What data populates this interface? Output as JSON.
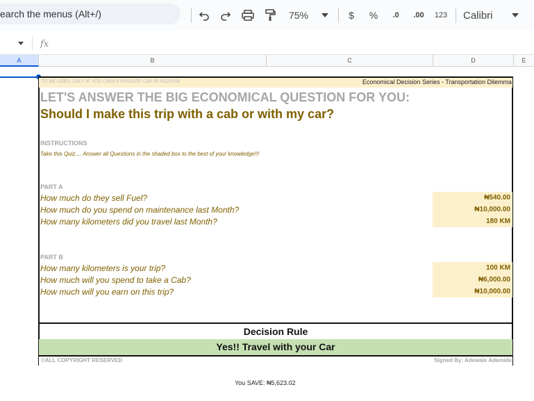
{
  "toolbar": {
    "search_text": "earch the menus (Alt+/)",
    "zoom": "75%",
    "currency_symbol": "$",
    "percent_symbol": "%",
    "decrease_decimal": ".0",
    "increase_decimal": ".00",
    "number_format": "123",
    "font_name": "Calibri"
  },
  "formula_bar": {
    "fx_label": "fx"
  },
  "columns": [
    "A",
    "B",
    "C",
    "D",
    "E"
  ],
  "sheet": {
    "note": "TO BE USED ONLY IF YOU OWN A PRIVATE CAR IN NIGERIA",
    "series": "Economical Decision Series - Transportation Dilemma",
    "heading": "LET'S ANSWER THE BIG ECONOMICAL QUESTION FOR YOU:",
    "question": "Should I make this trip with a cab or with my car?",
    "instructions_label": "INSTRUCTIONS",
    "instructions_text": "Take this Quiz.... Answer all Questions in the shaded box to the best of your knowledge!!!",
    "part_a": {
      "label": "PART A",
      "rows": [
        {
          "q": "How much do they sell Fuel?",
          "a": "₦540.00"
        },
        {
          "q": "How much do you spend on maintenance last Month?",
          "a": "₦10,000.00"
        },
        {
          "q": "How many kilometers did you travel last Month?",
          "a": "180 KM"
        }
      ]
    },
    "part_b": {
      "label": "PART B",
      "rows": [
        {
          "q": "How many kilometers is your trip?",
          "a": "100 KM"
        },
        {
          "q": "How much will you spend to take a Cab?",
          "a": "₦6,000.00"
        },
        {
          "q": "How much will you earn on this trip?",
          "a": "₦10,000.00"
        }
      ]
    },
    "decision_rule": "Decision Rule",
    "decision_result": "Yes!! Travel with your Car",
    "copyright": "©ALL COPYRIGHT RESERVED",
    "signed": "Signed By: Adewale Ademide",
    "you_save": "You SAVE:  ₦5,623.02"
  }
}
